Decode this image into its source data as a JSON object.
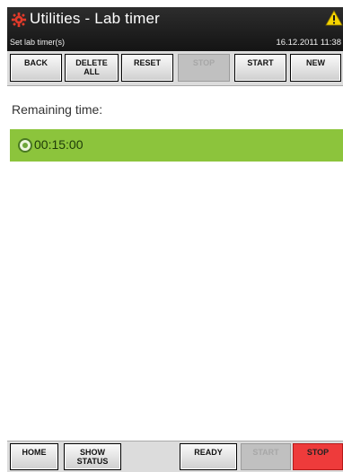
{
  "header": {
    "title": "Utilities - Lab timer",
    "subtitle": "Set lab timer(s)",
    "datetime": "16.12.2011 11:38",
    "app_icon": "settings-gear-icon",
    "warning_icon": "warning-triangle-icon",
    "background_color": "#1e1e1e",
    "warning_color": "#f5d400"
  },
  "toolbar": {
    "back": "BACK",
    "delete_all_line1": "DELETE",
    "delete_all_line2": "ALL",
    "reset": "RESET",
    "stop": "STOP",
    "start": "START",
    "new": "NEW"
  },
  "main": {
    "remaining_label": "Remaining time:",
    "timers": [
      {
        "time": "00:15:00",
        "selected": true
      }
    ],
    "row_color": "#8cc43c"
  },
  "bottombar": {
    "home": "HOME",
    "show_status_line1": "SHOW",
    "show_status_line2": "STATUS",
    "ready": "READY",
    "start": "START",
    "stop": "STOP",
    "stop_color": "#ee3b3b"
  }
}
